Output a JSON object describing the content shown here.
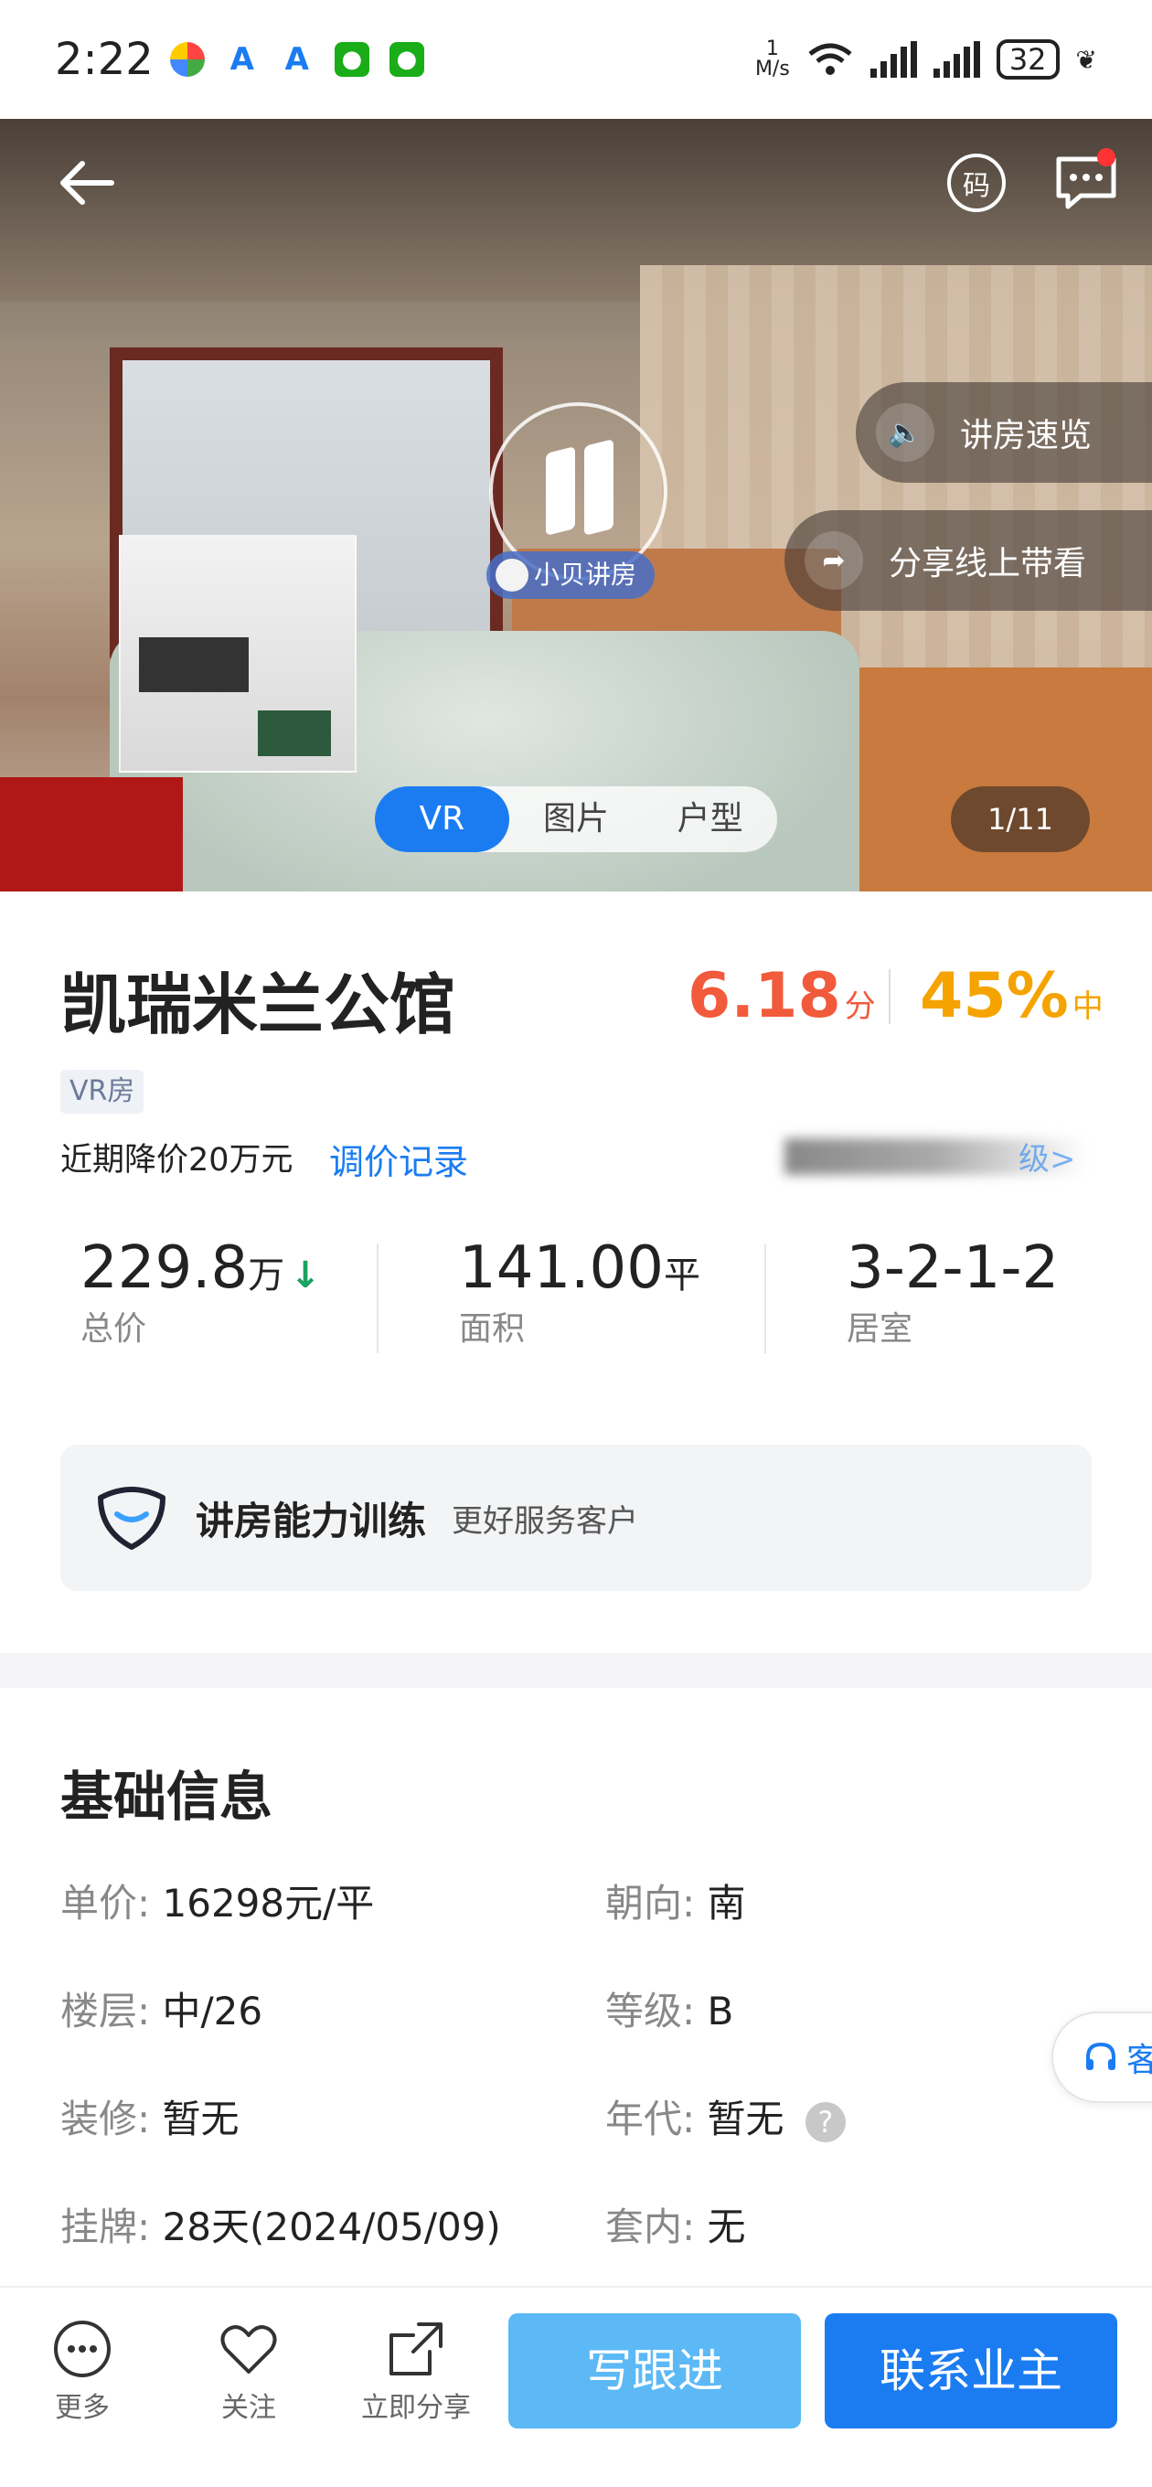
{
  "status_bar": {
    "time": "2:22",
    "network_speed": "1\nM/s",
    "battery": "32"
  },
  "hero": {
    "vr_badge": "小贝讲房",
    "side_buttons": [
      {
        "label": "讲房速览",
        "icon": "speaker-icon"
      },
      {
        "label": "分享线上带看",
        "icon": "share-arrow-icon"
      }
    ],
    "tabs": [
      {
        "label": "VR",
        "active": true
      },
      {
        "label": "图片",
        "active": false
      },
      {
        "label": "户型",
        "active": false
      }
    ],
    "counter": "1/11",
    "qr_label": "码"
  },
  "listing": {
    "title": "凯瑞米兰公馆",
    "score": "6.18",
    "score_unit": "分",
    "percent": "45%",
    "percent_unit": "中",
    "tag": "VR房",
    "price_drop": "近期降价20万元",
    "price_history_link": "调价记录",
    "blurred_link_suffix": "级>"
  },
  "stats": [
    {
      "value": "229.8",
      "unit": "万",
      "label": "总价",
      "trend": "down"
    },
    {
      "value": "141.00",
      "unit": "平",
      "label": "面积"
    },
    {
      "value": "3-2-1-2",
      "unit": "",
      "label": "居室"
    }
  ],
  "training": {
    "title": "讲房能力训练",
    "subtitle": "更好服务客户"
  },
  "basic_info": {
    "title": "基础信息",
    "rows": [
      {
        "left_key": "单价:",
        "left_val": "16298元/平",
        "right_key": "朝向:",
        "right_val": "南"
      },
      {
        "left_key": "楼层:",
        "left_val": "中/26",
        "right_key": "等级:",
        "right_val": "B"
      },
      {
        "left_key": "装修:",
        "left_val": "暂无",
        "right_key": "年代:",
        "right_val": "暂无"
      },
      {
        "left_key": "挂牌:",
        "left_val": "28天(2024/05/09)",
        "right_key": "套内:",
        "right_val": "无"
      }
    ]
  },
  "service_tab": "客",
  "bottom_bar": {
    "more": "更多",
    "follow": "关注",
    "share": "立即分享",
    "write_followup": "写跟进",
    "contact_owner": "联系业主"
  },
  "colors": {
    "accent_blue": "#1b7cf2",
    "light_blue": "#5cb9f5",
    "score_red": "#f25a3c",
    "percent_orange": "#f5a300",
    "drop_green": "#1aa260"
  }
}
